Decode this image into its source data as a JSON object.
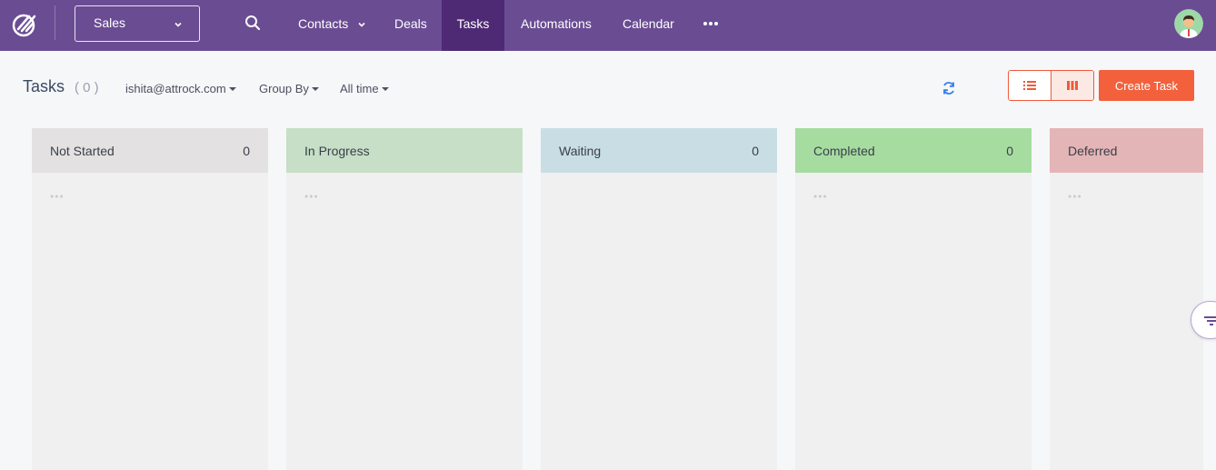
{
  "nav": {
    "pipeline": "Sales",
    "items": [
      "Contacts",
      "Deals",
      "Tasks",
      "Automations",
      "Calendar"
    ],
    "active": "Tasks"
  },
  "toolbar": {
    "title": "Tasks",
    "count": "( 0 )",
    "owner": "ishita@attrock.com",
    "group_by": "Group By",
    "time_range": "All time",
    "create_label": "Create Task"
  },
  "columns": [
    {
      "name": "Not Started",
      "count": "0",
      "color": "#e3e1e1"
    },
    {
      "name": "In Progress",
      "count": "",
      "color": "#c6dfc6"
    },
    {
      "name": "Waiting",
      "count": "0",
      "color": "#c8dee4"
    },
    {
      "name": "Completed",
      "count": "0",
      "color": "#a6dca0"
    },
    {
      "name": "Deferred",
      "count": "",
      "color": "#e4b5b6"
    }
  ],
  "colors": {
    "nav_bg": "#6a4c93",
    "nav_active": "#4f2a74",
    "accent": "#f2603c",
    "refresh": "#2f80ed"
  },
  "icons": [
    "logo-icon",
    "chevron-down-icon",
    "search-icon",
    "more-icon",
    "avatar",
    "refresh-icon",
    "list-view-icon",
    "board-view-icon",
    "filter-icon"
  ]
}
